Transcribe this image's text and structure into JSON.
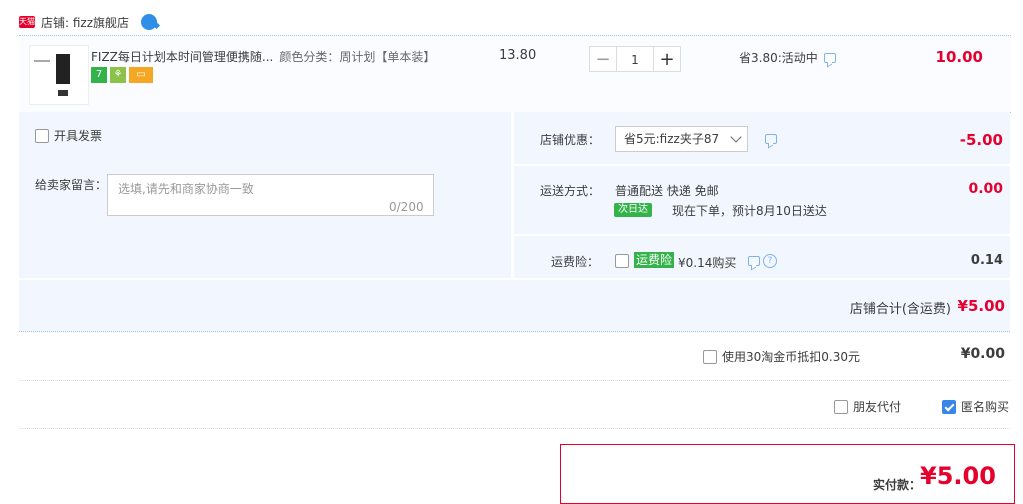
{
  "shop": {
    "badge": "天猫",
    "label": "店铺: fizz旗舰店"
  },
  "product": {
    "title": "FIZZ每日计划本时间管理便携随...",
    "sku": "颜色分类：周计划【单本装】",
    "unit_price": "13.80",
    "quantity": "1",
    "minus": "−",
    "plus": "+",
    "promo": "省3.80:活动中",
    "total": "10.00",
    "tags": [
      "7",
      "⚘",
      "▭"
    ]
  },
  "options": {
    "invoice_label": "开具发票",
    "memo_label": "给卖家留言：",
    "memo_placeholder": "选填,请先和商家协商一致",
    "memo_count": "0/200"
  },
  "discount": {
    "label": "店铺优惠：",
    "selected": "省5元:fizz夹子87",
    "amount": "-5.00"
  },
  "shipping": {
    "label": "运送方式：",
    "method": "普通配送 快递 免邮",
    "badge": "次日达",
    "eta": "现在下单，预计8月10日送达",
    "amount": "0.00"
  },
  "insurance": {
    "label": "运费险：",
    "badge": "运费险",
    "text": "¥0.14购买",
    "amount": "0.14"
  },
  "subtotal": {
    "label": "店铺合计(含运费)",
    "amount": "¥5.00"
  },
  "coins": {
    "label": "使用30淘金币抵扣0.30元",
    "amount": "¥0.00"
  },
  "extras": {
    "friend_pay": "朋友代付",
    "anonymous": "匿名购买"
  },
  "payment": {
    "label": "实付款：",
    "amount": "¥5.00"
  },
  "colors": {
    "accent_red": "#e5002d",
    "panel_blue": "#f2f7ff",
    "badge_green": "#33b34a"
  }
}
